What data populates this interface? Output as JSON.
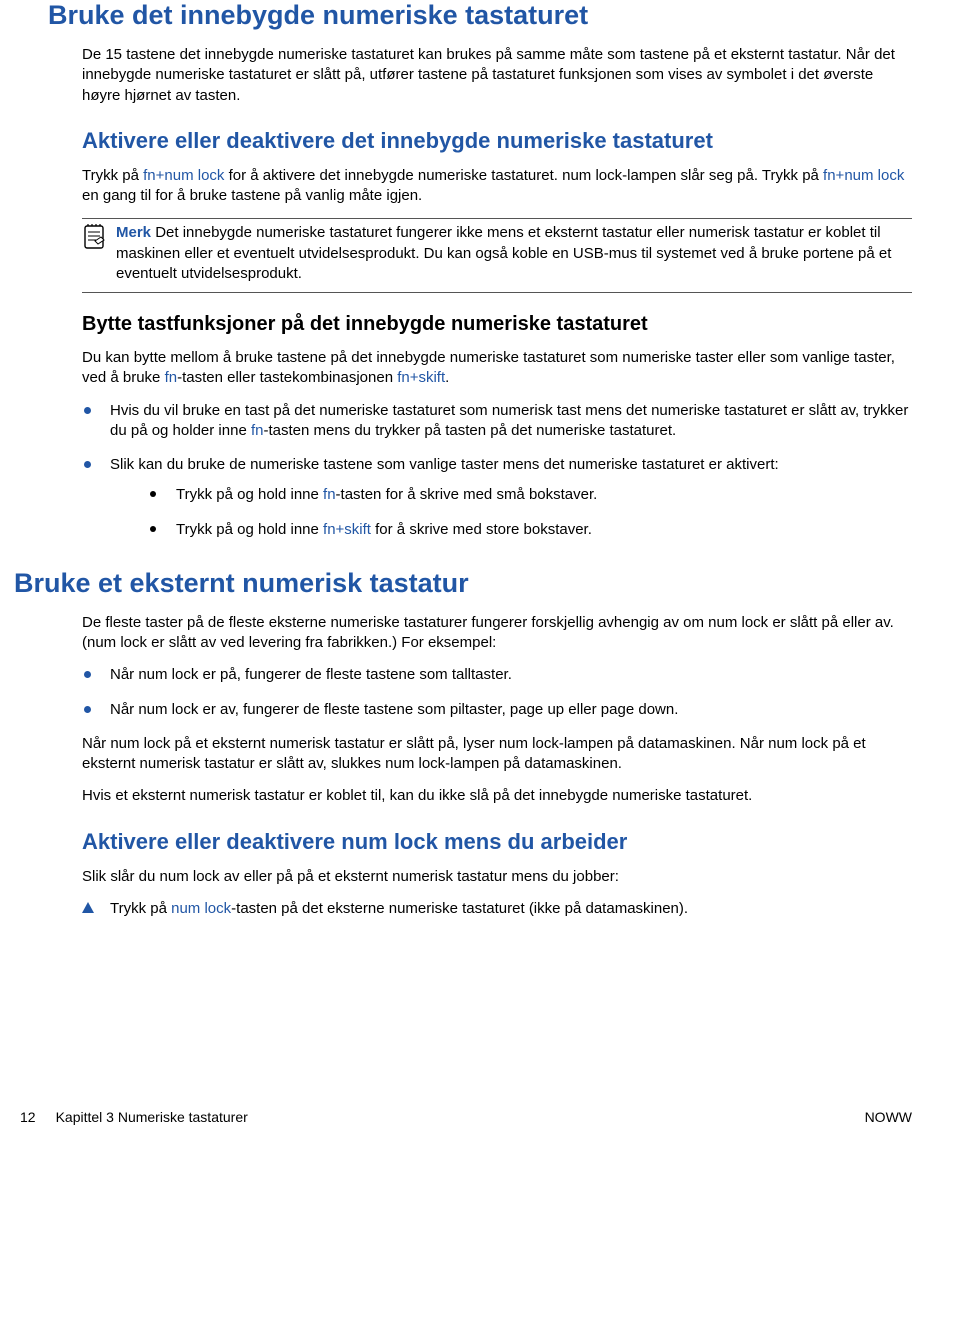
{
  "h1a": "Bruke det innebygde numeriske tastaturet",
  "p1": "De 15 tastene det innebygde numeriske tastaturet kan brukes på samme måte som tastene på et eksternt tastatur. Når det innebygde numeriske tastaturet er slått på, utfører tastene på tastaturet funksjonen som vises av symbolet i det øverste høyre hjørnet av tasten.",
  "h2a": "Aktivere eller deaktivere det innebygde numeriske tastaturet",
  "p2a": "Trykk på ",
  "p2b": "fn+num lock",
  "p2c": " for å aktivere det innebygde numeriske tastaturet. num lock-lampen slår seg på. Trykk på ",
  "p2d": "fn+num lock",
  "p2e": " en gang til for å bruke tastene på vanlig måte igjen.",
  "note_label": "Merk",
  "note_body": " Det innebygde numeriske tastaturet fungerer ikke mens et eksternt tastatur eller numerisk tastatur er koblet til maskinen eller et eventuelt utvidelsesprodukt. Du kan også koble en USB-mus til systemet ved å bruke portene på et eventuelt utvidelsesprodukt.",
  "h3a": "Bytte tastfunksjoner på det innebygde numeriske tastaturet",
  "p3a": "Du kan bytte mellom å bruke tastene på det innebygde numeriske tastaturet som numeriske taster eller som vanlige taster, ved å bruke ",
  "p3b": "fn",
  "p3c": "-tasten eller tastekombinasjonen ",
  "p3d": "fn+skift",
  "p3e": ".",
  "li1a": "Hvis du vil bruke en tast på det numeriske tastaturet som numerisk tast mens det numeriske tastaturet er slått av, trykker du på og holder inne ",
  "li1b": "fn",
  "li1c": "-tasten mens du trykker på tasten på det numeriske tastaturet.",
  "li2": "Slik kan du bruke de numeriske tastene som vanlige taster mens det numeriske tastaturet er aktivert:",
  "li2_1a": "Trykk på og hold inne ",
  "li2_1b": "fn",
  "li2_1c": "-tasten for å skrive med små bokstaver.",
  "li2_2a": "Trykk på og hold inne ",
  "li2_2b": "fn+skift",
  "li2_2c": " for å skrive med store bokstaver.",
  "h1b": "Bruke et eksternt numerisk tastatur",
  "p4": "De fleste taster på de fleste eksterne numeriske tastaturer fungerer forskjellig avhengig av om num lock er slått på eller av. (num lock er slått av ved levering fra fabrikken.) For eksempel:",
  "li3": "Når num lock er på, fungerer de fleste tastene som talltaster.",
  "li4": "Når num lock er av, fungerer de fleste tastene som piltaster, page up eller page down.",
  "p5": "Når num lock på et eksternt numerisk tastatur er slått på, lyser num lock-lampen på datamaskinen. Når num lock på et eksternt numerisk tastatur er slått av, slukkes num lock-lampen på datamaskinen.",
  "p6": "Hvis et eksternt numerisk tastatur er koblet til, kan du ikke slå på det innebygde numeriske tastaturet.",
  "h2b": "Aktivere eller deaktivere num lock mens du arbeider",
  "p7": "Slik slår du num lock av eller på på et eksternt numerisk tastatur mens du jobber:",
  "tri1a": "Trykk på ",
  "tri1b": "num lock",
  "tri1c": "-tasten på det eksterne numeriske tastaturet (ikke på datamaskinen).",
  "footer_page": "12",
  "footer_chapter": "Kapittel 3   Numeriske tastaturer",
  "footer_right": "NOWW"
}
